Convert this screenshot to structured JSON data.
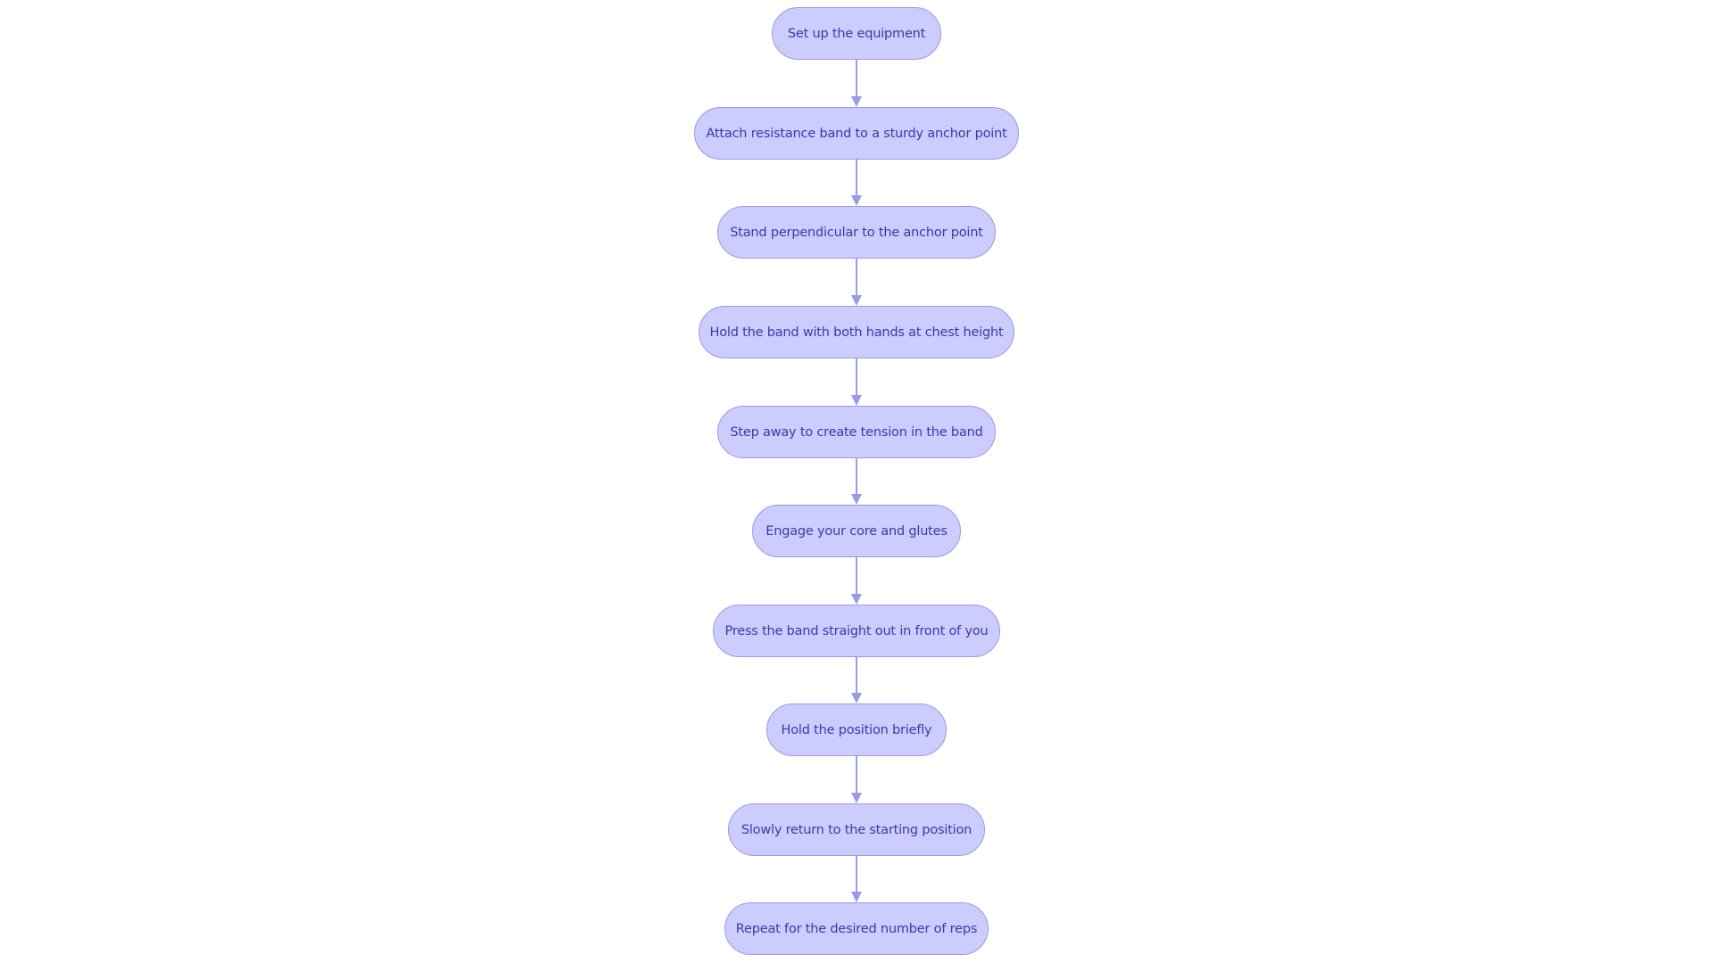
{
  "diagram": {
    "type": "flowchart",
    "direction": "top-to-bottom",
    "colors": {
      "node_fill": "#ccccff",
      "node_border": "#9a9ae6",
      "node_text": "#3a3aa8",
      "edge": "#9a9ae6",
      "background": "#ffffff"
    },
    "nodes": [
      {
        "id": "n1",
        "label": "Set up the equipment"
      },
      {
        "id": "n2",
        "label": "Attach resistance band to a sturdy anchor point"
      },
      {
        "id": "n3",
        "label": "Stand perpendicular to the anchor point"
      },
      {
        "id": "n4",
        "label": "Hold the band with both hands at chest height"
      },
      {
        "id": "n5",
        "label": "Step away to create tension in the band"
      },
      {
        "id": "n6",
        "label": "Engage your core and glutes"
      },
      {
        "id": "n7",
        "label": "Press the band straight out in front of you"
      },
      {
        "id": "n8",
        "label": "Hold the position briefly"
      },
      {
        "id": "n9",
        "label": "Slowly return to the starting position"
      },
      {
        "id": "n10",
        "label": "Repeat for the desired number of reps"
      }
    ],
    "edges": [
      {
        "from": "n1",
        "to": "n2"
      },
      {
        "from": "n2",
        "to": "n3"
      },
      {
        "from": "n3",
        "to": "n4"
      },
      {
        "from": "n4",
        "to": "n5"
      },
      {
        "from": "n5",
        "to": "n6"
      },
      {
        "from": "n6",
        "to": "n7"
      },
      {
        "from": "n7",
        "to": "n8"
      },
      {
        "from": "n8",
        "to": "n9"
      },
      {
        "from": "n9",
        "to": "n10"
      }
    ]
  }
}
